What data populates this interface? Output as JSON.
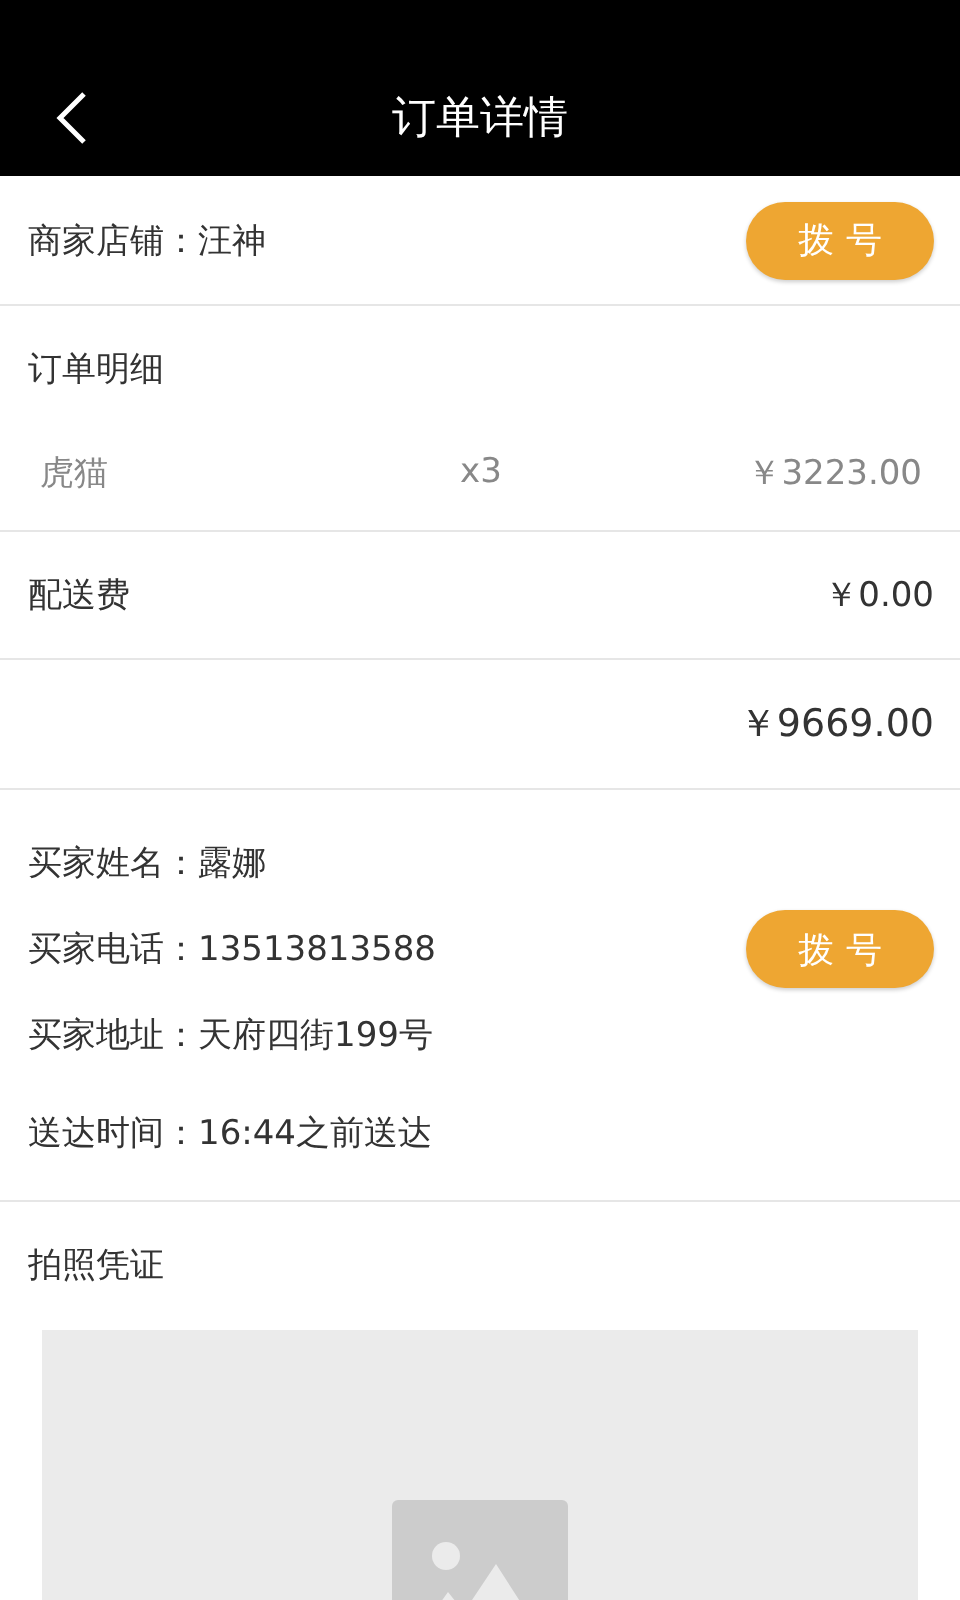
{
  "header": {
    "title": "订单详情"
  },
  "merchant": {
    "label": "商家店铺：汪神",
    "button": "拨 号"
  },
  "order_details": {
    "title": "订单明细",
    "items": [
      {
        "name": "虎猫",
        "quantity": "x3",
        "price": "￥3223.00"
      }
    ],
    "delivery_fee": {
      "label": "配送费",
      "amount": "￥0.00"
    },
    "total": "￥9669.00"
  },
  "buyer": {
    "fields": [
      {
        "text": "买家姓名：露娜"
      },
      {
        "text": "买家电话：13513813588",
        "button": "拨 号"
      },
      {
        "text": "买家地址：天府四街199号"
      },
      {
        "text": "送达时间：16:44之前送达"
      }
    ]
  },
  "photo_proof": {
    "title": "拍照凭证"
  }
}
